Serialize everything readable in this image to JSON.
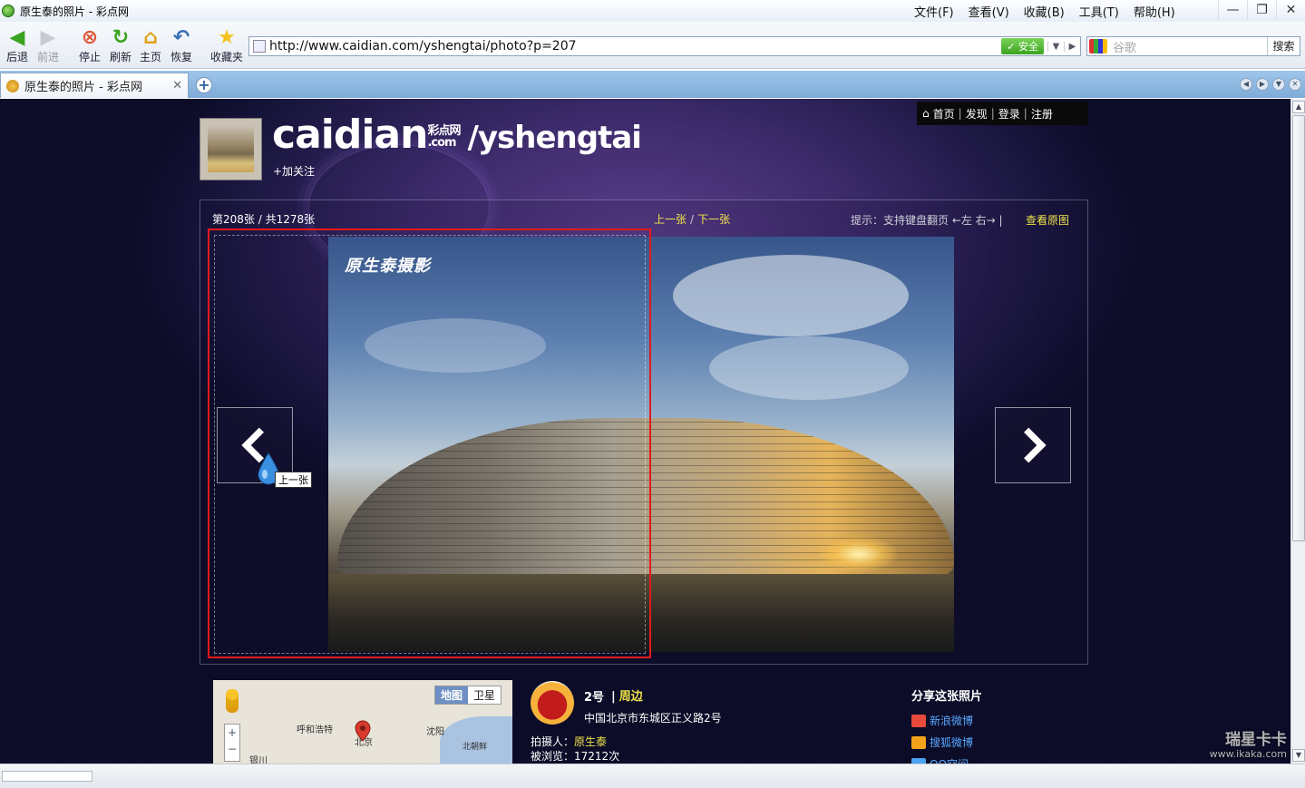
{
  "window": {
    "title": "原生泰的照片 - 彩点网",
    "menus": [
      "文件(F)",
      "查看(V)",
      "收藏(B)",
      "工具(T)",
      "帮助(H)"
    ]
  },
  "toolbar": {
    "back": "后退",
    "forward": "前进",
    "stop": "停止",
    "refresh": "刷新",
    "home": "主页",
    "restore": "恢复",
    "favorites": "收藏夹"
  },
  "address": {
    "url": "http://www.caidian.com/yshengtai/photo?p=207",
    "safe_label": "✓ 安全"
  },
  "search": {
    "placeholder": "谷歌",
    "button": "搜索"
  },
  "tabs": [
    {
      "title": "原生泰的照片 - 彩点网"
    }
  ],
  "site": {
    "nav": [
      "首页",
      "发现",
      "登录",
      "注册"
    ],
    "logo_main": "caidian",
    "logo_cn_top": "彩点网",
    "logo_cn_bottom": ".com",
    "username": "/yshengtai",
    "follow": "+加关注"
  },
  "viewer": {
    "counter": "第208张  / 共1278张",
    "prev": "上一张",
    "separator": "/",
    "next": "下一张",
    "hint": "提示：支持键盘翻页 ←左  右→ |",
    "view_original": "查看原图",
    "watermark": "原生泰摄影",
    "tooltip": "上一张"
  },
  "map": {
    "tab_map": "地图",
    "tab_satellite": "卫星",
    "cities": [
      "呼和浩特",
      "北京",
      "沈阳",
      "银川",
      "北朝鲜"
    ]
  },
  "place": {
    "number": "2号",
    "separator": "|",
    "nearby": "周边",
    "address": "中国北京市东城区正义路2号",
    "photographer_label": "拍摄人：",
    "photographer": "原生泰",
    "views_label": "被浏览：",
    "views": "17212次"
  },
  "share": {
    "title": "分享这张照片",
    "items": [
      "新浪微博",
      "搜狐微博",
      "QQ空间"
    ]
  },
  "brand_watermark": {
    "line1": "瑞星卡卡",
    "line2": "www.ikaka.com"
  },
  "colors": {
    "accent_yellow": "#f0e34a",
    "highlight_red": "#e31a1a",
    "link_blue": "#5aa9ff"
  }
}
